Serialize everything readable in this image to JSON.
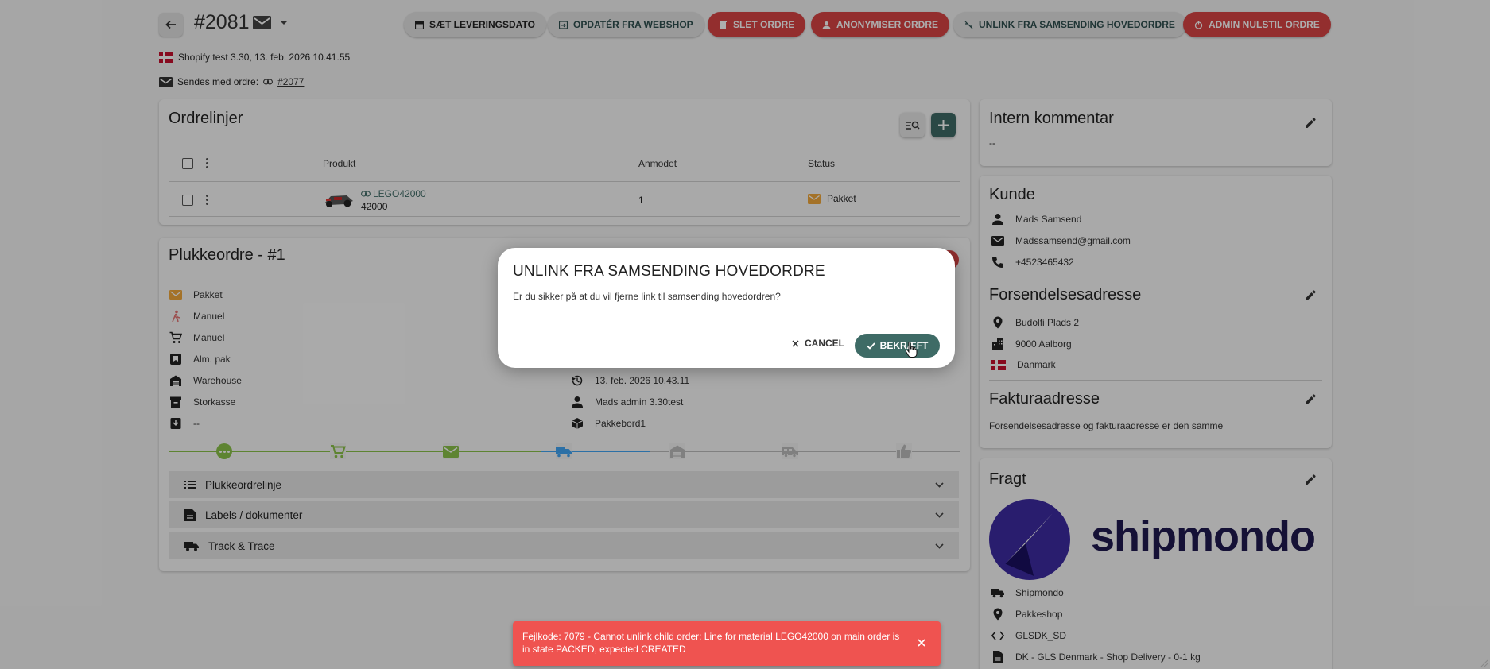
{
  "header": {
    "order_number": "#2081",
    "buttons": [
      {
        "label": "SÆT LEVERINGSDATO",
        "icon": "calendar-icon"
      },
      {
        "label": "OPDATÉR FRA WEBSHOP",
        "icon": "refresh-icon"
      },
      {
        "label": "SLET ORDRE",
        "icon": "trash-icon"
      },
      {
        "label": "ANONYMISER ORDRE",
        "icon": "anonymize-icon"
      },
      {
        "label": "UNLINK FRA SAMSENDING HOVEDORDRE",
        "icon": "unlink-icon"
      },
      {
        "label": "ADMIN NULSTIL ORDRE",
        "icon": "reset-icon"
      }
    ],
    "source_line": "Shopify test 3.30, 13. feb. 2026 10.41.55",
    "ship_with_label": "Sendes med ordre:",
    "ship_with_link": "#2077"
  },
  "orderlines": {
    "title": "Ordrelinjer",
    "columns": [
      "Produkt",
      "Anmodet",
      "Status"
    ],
    "rows": [
      {
        "product_sku": "LEGO42000",
        "product_id": "42000",
        "requested": "1",
        "status": "Pakket"
      }
    ]
  },
  "pick_order": {
    "title": "Plukkeordre - #1",
    "left_items": [
      {
        "icon": "envelope-icon",
        "text": "Pakket"
      },
      {
        "icon": "walking-person-icon",
        "text": "Manuel"
      },
      {
        "icon": "cart-icon",
        "text": "Manuel"
      },
      {
        "icon": "package-type-icon",
        "text": "Alm. pak"
      },
      {
        "icon": "warehouse-icon",
        "text": "Warehouse"
      },
      {
        "icon": "box-icon",
        "text": "Storkasse"
      },
      {
        "icon": "archive-icon",
        "text": "--"
      }
    ],
    "right_items": [
      {
        "icon": "history-icon",
        "text": "13. feb. 2026 10.43.11"
      },
      {
        "icon": "person-icon",
        "text": "Mads admin 3.30test"
      },
      {
        "icon": "packing-station-icon",
        "text": "Pakkebord1"
      }
    ],
    "accordions": [
      "Plukkeordrelinje",
      "Labels / dokumenter",
      "Track & Trace"
    ]
  },
  "comment": {
    "title": "Intern kommentar",
    "text": "--"
  },
  "customer": {
    "title": "Kunde",
    "name": "Mads Samsend",
    "email": "Madssamsend@gmail.com",
    "phone": "+4523465432"
  },
  "shipping_address": {
    "title": "Forsendelsesadresse",
    "street": "Budolfi Plads 2",
    "city": "9000 Aalborg",
    "country": "Danmark"
  },
  "invoice_address": {
    "title": "Fakturaadresse",
    "text": "Forsendelsesadresse og fakturaadresse er den samme"
  },
  "freight": {
    "title": "Fragt",
    "logo_text": "shipmondo",
    "carrier": "Shipmondo",
    "service": "Pakkeshop",
    "code": "GLSDK_SD",
    "product": "DK - GLS Denmark - Shop Delivery - 0-1 kg"
  },
  "dialog": {
    "title": "UNLINK FRA SAMSENDING HOVEDORDRE",
    "text": "Er du sikker på at du vil fjerne link til samsending hovedordren?",
    "cancel": "CANCEL",
    "confirm": "BEKRÆFT"
  },
  "toast": {
    "text": "Fejlkode: 7079 - Cannot unlink child order: Line for material LEGO42000 on main order is in state PACKED, expected CREATED"
  },
  "colors": {
    "accent": "#3e6b66",
    "danger": "#d94444",
    "toast": "#ef5350",
    "done": "#8bc34a",
    "active": "#42a5f5"
  }
}
